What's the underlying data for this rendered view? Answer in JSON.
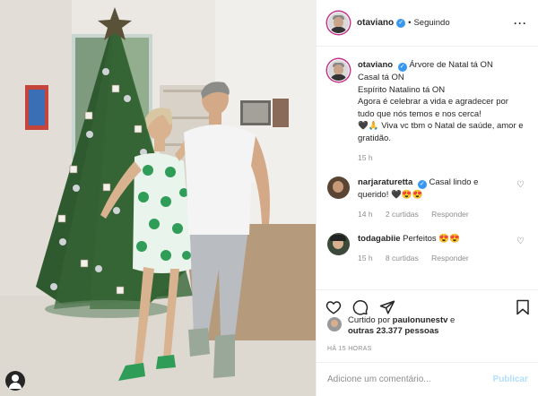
{
  "post": {
    "author": "otaviano",
    "follow_status": "Seguindo",
    "separator": "•",
    "caption": {
      "username": "otaviano",
      "lines": [
        "Árvore de Natal tá ON",
        "Casal tá ON",
        "Espírito Natalino tá ON",
        "Agora é celebrar a vida e agradecer por tudo que nós temos e nos cerca!",
        "🖤🙏 Viva vc tbm o Natal de saúde, amor e gratidão."
      ],
      "time": "15 h"
    },
    "comments": [
      {
        "username": "narjaraturetta",
        "verified": true,
        "text": "Casal lindo e querido! 🖤😍😍",
        "time": "14 h",
        "likes": "2 curtidas",
        "reply": "Responder"
      },
      {
        "username": "todagabiie",
        "verified": false,
        "text": "Perfeitos 😍😍",
        "time": "15 h",
        "likes": "8 curtidas",
        "reply": "Responder"
      }
    ],
    "liked_by": {
      "prefix": "Curtido por",
      "user": "paulonunestv",
      "conjunction": "e",
      "others": "outras 23.377 pessoas"
    },
    "timestamp": "HÁ 15 HORAS",
    "add_comment": {
      "placeholder": "Adicione um comentário...",
      "submit": "Publicar"
    }
  },
  "colors": {
    "verified": "#3897f0",
    "muted": "#8e8e8e",
    "publish_disabled": "#b2dffc",
    "dress_green": "#2f9c57"
  },
  "icons": [
    "more-options-icon",
    "heart-icon",
    "comment-icon",
    "share-icon",
    "bookmark-icon",
    "verified-icon"
  ]
}
